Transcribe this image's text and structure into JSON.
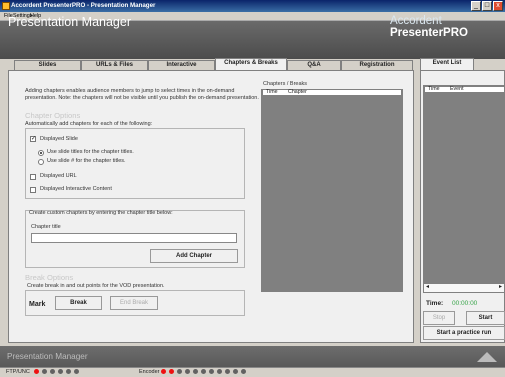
{
  "window": {
    "title": "Accordent PresenterPRO - Presentation Manager",
    "buttons": [
      "_",
      "□",
      "x"
    ]
  },
  "menu": {
    "items": [
      "File",
      "Settings",
      "Help"
    ]
  },
  "header": {
    "title": "Presentation Manager",
    "brand_prefix": "Accordent",
    "brand_bold": "PresenterPRO"
  },
  "tabs": [
    "Slides",
    "URLs & Files",
    "Interactive",
    "Chapters & Breaks",
    "Q&A",
    "Registration"
  ],
  "event_list_tab": "Event List",
  "chapter_panel": {
    "intro": "Adding chapters enables audience members to jump to select times in the on-demand presentation. Note: the chapters will not be visible until you publish the on-demand presentation.",
    "options_heading": "Chapter Options",
    "auto_label": "Automatically add chapters for each of the following:",
    "displayed_slide": "Displayed Slide",
    "use_slide_titles": "Use slide titles for the chapter titles.",
    "use_slide_numbers": "Use slide # for the chapter titles.",
    "displayed_url": "Displayed URL",
    "displayed_interactive": "Displayed Interactive Content",
    "custom_label": "Create custom chapters by entering the chapter title below:",
    "chapter_title_label": "Chapter title",
    "chapter_title_value": "",
    "add_chapter": "Add Chapter",
    "break_heading": "Break Options",
    "break_label": "Create break in and out points for the VOD presentation.",
    "mark": "Mark",
    "break": "Break",
    "end_break": "End Break"
  },
  "chapters_breaks": {
    "heading": "Chapters / Breaks",
    "columns": [
      "Time",
      "Chapter"
    ]
  },
  "event_list": {
    "columns": [
      "Time",
      "Event"
    ]
  },
  "controls": {
    "time_label": "Time:",
    "time_value": "00:00:00",
    "stop": "Stop",
    "start": "Start",
    "practice": "Start a practice run"
  },
  "footer": {
    "title": "Presentation Manager"
  },
  "status": {
    "ftp_label": "FTP/UNC",
    "encoder_label": "Encoder"
  }
}
